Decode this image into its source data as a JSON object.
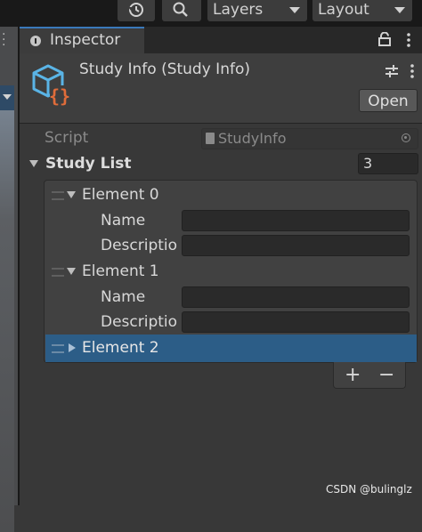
{
  "toolbar": {
    "layers_label": "Layers",
    "layout_label": "Layout",
    "history_icon": "history-icon",
    "search_icon": "search-icon"
  },
  "inspector": {
    "tab_label": "Inspector",
    "header": {
      "title": "Study Info (Study Info)",
      "open_label": "Open"
    },
    "script": {
      "label": "Script",
      "value": "StudyInfo"
    },
    "list": {
      "label": "Study List",
      "size": "3",
      "elements": [
        {
          "label": "Element 0",
          "expanded": true,
          "name_label": "Name",
          "desc_label": "Descriptio"
        },
        {
          "label": "Element 1",
          "expanded": true,
          "name_label": "Name",
          "desc_label": "Descriptio"
        },
        {
          "label": "Element 2",
          "expanded": false,
          "selected": true
        }
      ],
      "add_label": "+",
      "remove_label": "−"
    }
  },
  "watermark": "CSDN @bulinglz",
  "colors": {
    "accent": "#3a79bb",
    "selection": "#2c5d87",
    "icon_cube": "#5ab4e6",
    "icon_braces": "#e06c3a"
  }
}
